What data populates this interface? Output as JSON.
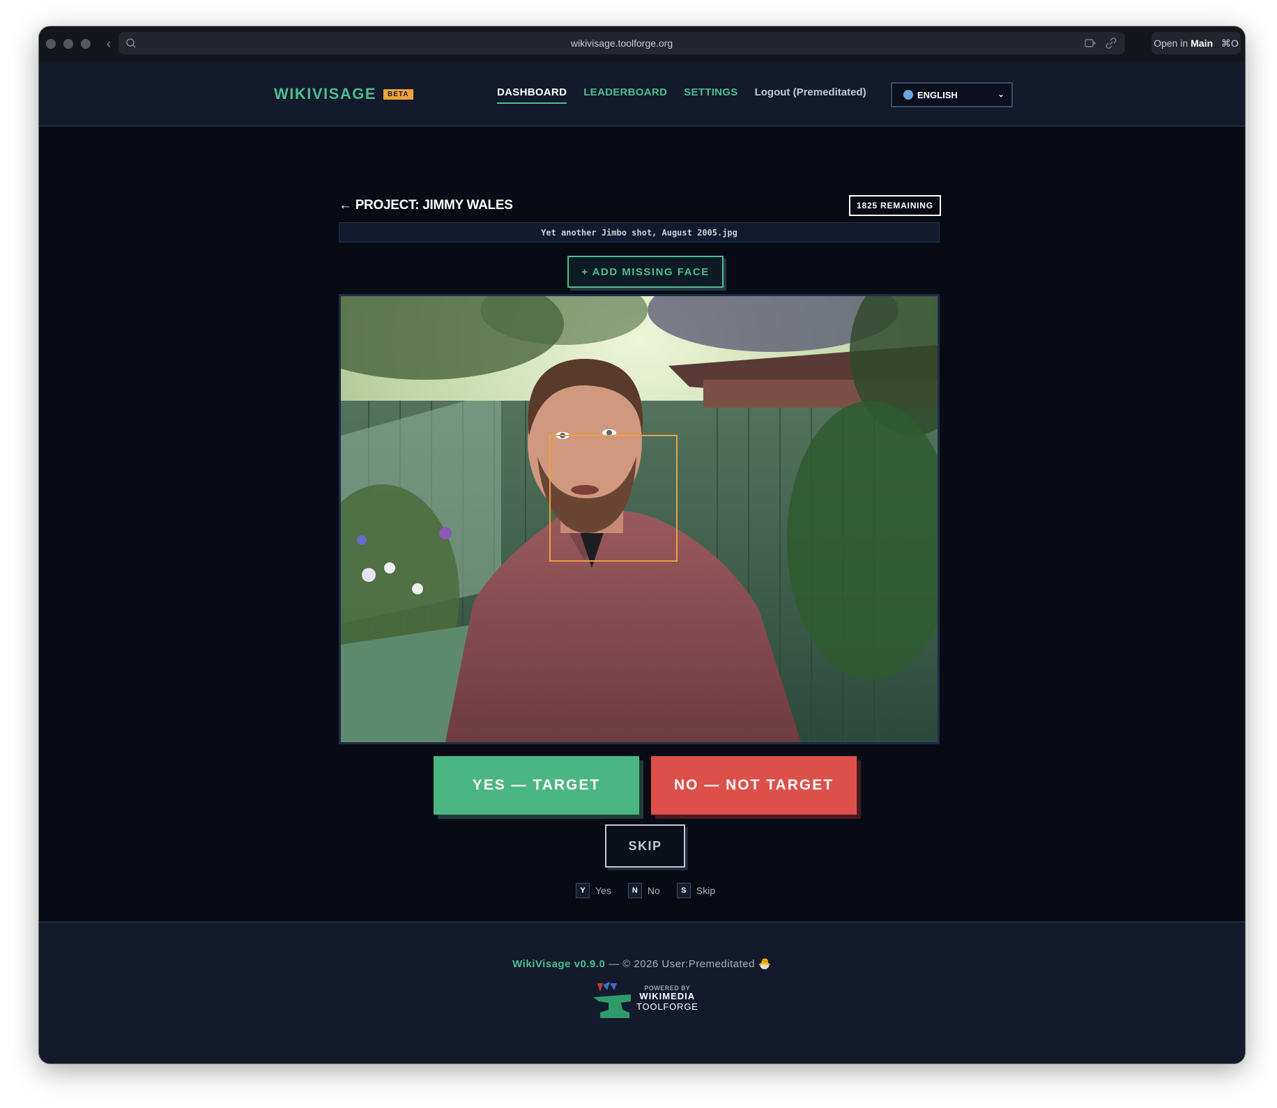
{
  "browser": {
    "url": "wikivisage.toolforge.org",
    "open_in_prefix": "Open in",
    "open_in_target": "Main",
    "open_in_shortcut": "⌘O"
  },
  "nav": {
    "brand": "WIKIVISAGE",
    "badge": "BETA",
    "links": [
      "DASHBOARD",
      "LEADERBOARD",
      "SETTINGS"
    ],
    "logout": "Logout (Premeditated)",
    "language": "ENGLISH"
  },
  "project": {
    "back_arrow": "←",
    "title": "PROJECT: JIMMY WALES",
    "remaining": "1825 REMAINING",
    "filename": "Yet another Jimbo shot, August 2005.jpg",
    "add_missing_face": "+ ADD MISSING FACE"
  },
  "actions": {
    "yes": "YES — TARGET",
    "no": "NO — NOT TARGET",
    "skip": "SKIP"
  },
  "shortcuts": [
    {
      "key": "Y",
      "label": "Yes"
    },
    {
      "key": "N",
      "label": "No"
    },
    {
      "key": "S",
      "label": "Skip"
    }
  ],
  "footer": {
    "version": "WikiVisage v0.9.0",
    "copyright": " — © 2026 User:Premeditated ",
    "emoji": "🐣",
    "powered_by": "POWERED BY",
    "wikimedia": "WIKIMEDIA",
    "toolforge": "TOOLFORGE"
  },
  "colors": {
    "accent": "#4cbf8f",
    "beta_badge": "#f0a23a",
    "face_box": "#f0a23a",
    "yes": "#4cb682",
    "no": "#dd504a",
    "background": "#080b14"
  }
}
